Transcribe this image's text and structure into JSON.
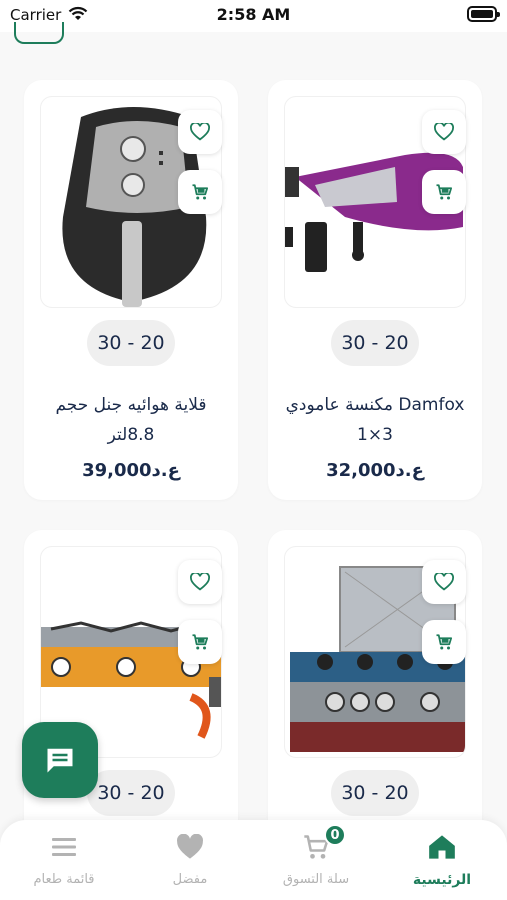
{
  "status_bar": {
    "carrier": "Carrier",
    "time": "2:58 AM"
  },
  "colors": {
    "accent": "#1e7d5b",
    "text": "#1a2a4a",
    "muted": "#b3b3b3"
  },
  "products": [
    {
      "title": "قلاية هوائيه جنل حجم 8.8لتر",
      "size": "30 - 20",
      "price": "39,000ع.د",
      "image": "air-fryer"
    },
    {
      "title": "Damfox مكنسة عامودي 3×1",
      "size": "30 - 20",
      "price": "32,000ع.د",
      "image": "vacuum-cleaner"
    },
    {
      "title": "",
      "size": "30 - 20",
      "price": "",
      "image": "gas-stove"
    },
    {
      "title": "",
      "size": "30 - 20",
      "price": "",
      "image": "gas-cooker"
    }
  ],
  "chat_fab": {
    "icon": "chat-icon"
  },
  "tabbar": {
    "items": [
      {
        "label": "قائمة طعام",
        "icon": "menu-icon",
        "active": false
      },
      {
        "label": "مفضل",
        "icon": "heart-icon",
        "active": false
      },
      {
        "label": "سلة التسوق",
        "icon": "cart-icon",
        "active": false,
        "badge": "0"
      },
      {
        "label": "الرئيسية",
        "icon": "home-icon",
        "active": true
      }
    ]
  }
}
